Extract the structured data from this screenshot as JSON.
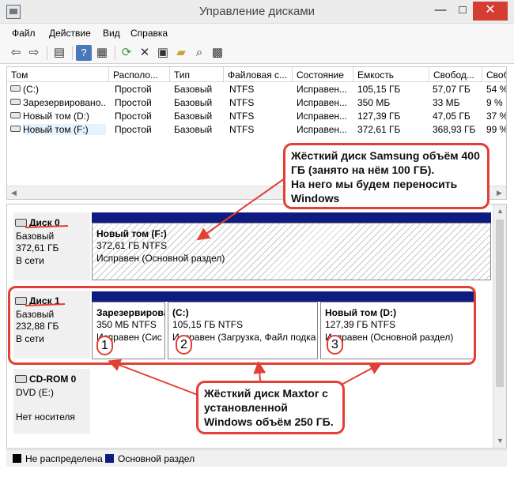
{
  "window": {
    "title": "Управление дисками",
    "minimize": "—",
    "maximize": "□",
    "close": "✕"
  },
  "menu": [
    "Файл",
    "Действие",
    "Вид",
    "Справка"
  ],
  "toolbar": {
    "icons": [
      "back-icon",
      "forward-icon",
      "show-hide-tree-icon",
      "help-icon",
      "properties-icon",
      "refresh-icon",
      "delete-icon",
      "options-icon",
      "open-icon",
      "search-icon",
      "settings-icon"
    ]
  },
  "volume_list": {
    "headers": [
      "Том",
      "Располо...",
      "Тип",
      "Файловая с...",
      "Состояние",
      "Емкость",
      "Свобод...",
      "Своб"
    ],
    "rows": [
      [
        "(C:)",
        "Простой",
        "Базовый",
        "NTFS",
        "Исправен...",
        "105,15 ГБ",
        "57,07 ГБ",
        "54 %"
      ],
      [
        "Зарезервировано...",
        "Простой",
        "Базовый",
        "NTFS",
        "Исправен...",
        "350 МБ",
        "33 МБ",
        "9 %"
      ],
      [
        "Новый том (D:)",
        "Простой",
        "Базовый",
        "NTFS",
        "Исправен...",
        "127,39 ГБ",
        "47,05 ГБ",
        "37 %"
      ],
      [
        "Новый том (F:)",
        "Простой",
        "Базовый",
        "NTFS",
        "Исправен...",
        "372,61 ГБ",
        "368,93 ГБ",
        "99 %"
      ]
    ]
  },
  "disks": [
    {
      "name": "Диск 0",
      "type": "Базовый",
      "size": "372,61 ГБ",
      "status": "В сети",
      "partitions": [
        {
          "title": "Новый том  (F:)",
          "size": "372,61 ГБ NTFS",
          "status": "Исправен (Основной раздел)"
        }
      ]
    },
    {
      "name": "Диск 1",
      "type": "Базовый",
      "size": "232,88 ГБ",
      "status": "В сети",
      "partitions": [
        {
          "title": "Зарезервирован",
          "size": "350 МБ NTFS",
          "status": "Исправен (Сис"
        },
        {
          "title": "(C:)",
          "size": "105,15 ГБ NTFS",
          "status": "Исправен (Загрузка, Файл подка"
        },
        {
          "title": "Новый том  (D:)",
          "size": "127,39 ГБ NTFS",
          "status": "Исправен (Основной раздел)"
        }
      ]
    },
    {
      "name": "CD-ROM 0",
      "type": "DVD (E:)",
      "status": "Нет носителя"
    }
  ],
  "badges": [
    "1",
    "2",
    "3"
  ],
  "legend": {
    "unallocated": "Не распределена",
    "primary": "Основной раздел",
    "unallocated_color": "#000000",
    "primary_color": "#0f1b80"
  },
  "callouts": {
    "samsung": [
      "Жёсткий диск Samsung объём 400",
      "ГБ (занято на нём 100 ГБ).",
      "На него мы будем переносить",
      "Windows"
    ],
    "maxtor": [
      "Жёсткий диск Maxtor с",
      "установленной",
      "Windows объём 250 ГБ."
    ]
  },
  "colors": {
    "accent_red": "#e23f35",
    "partition_bar": "#0f1b80",
    "close_button": "#d63d32"
  }
}
